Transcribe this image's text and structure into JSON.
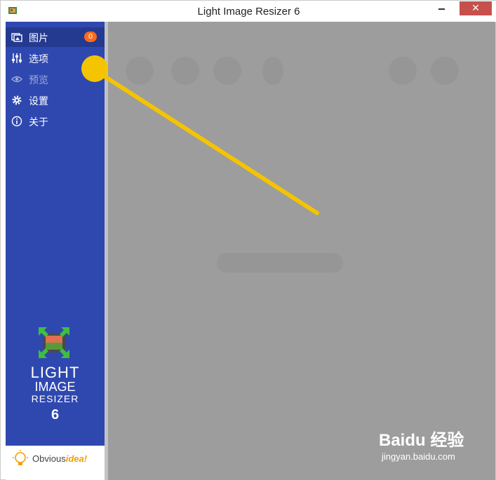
{
  "window": {
    "title": "Light Image Resizer 6",
    "close_label": "✕",
    "minimize_label": ""
  },
  "sidebar": {
    "items": [
      {
        "label": "图片",
        "icon": "pictures-icon",
        "active": true,
        "badge": "0"
      },
      {
        "label": "选项",
        "icon": "sliders-icon"
      },
      {
        "label": "预览",
        "icon": "eye-icon",
        "disabled": true
      },
      {
        "label": "设置",
        "icon": "gear-icon"
      },
      {
        "label": "关于",
        "icon": "info-icon"
      }
    ],
    "logo": {
      "line1": "LIGHT",
      "line2": "IMAGE",
      "line3": "RESIZER",
      "line4": "6"
    },
    "footer": {
      "brand_prefix": "Obvious",
      "brand_suffix": "idea!"
    }
  },
  "annotation": {
    "color": "#f5c400",
    "marker": "yellow-circle-with-arrow"
  },
  "watermark": {
    "line1": "Baidu 经验",
    "line2": "jingyan.baidu.com"
  },
  "colors": {
    "sidebar": "#2f48b0",
    "sidebar_active": "#243a90",
    "badge": "#ff6a1a",
    "close_button": "#c7504c",
    "content_overlay": "#9d9d9d"
  }
}
